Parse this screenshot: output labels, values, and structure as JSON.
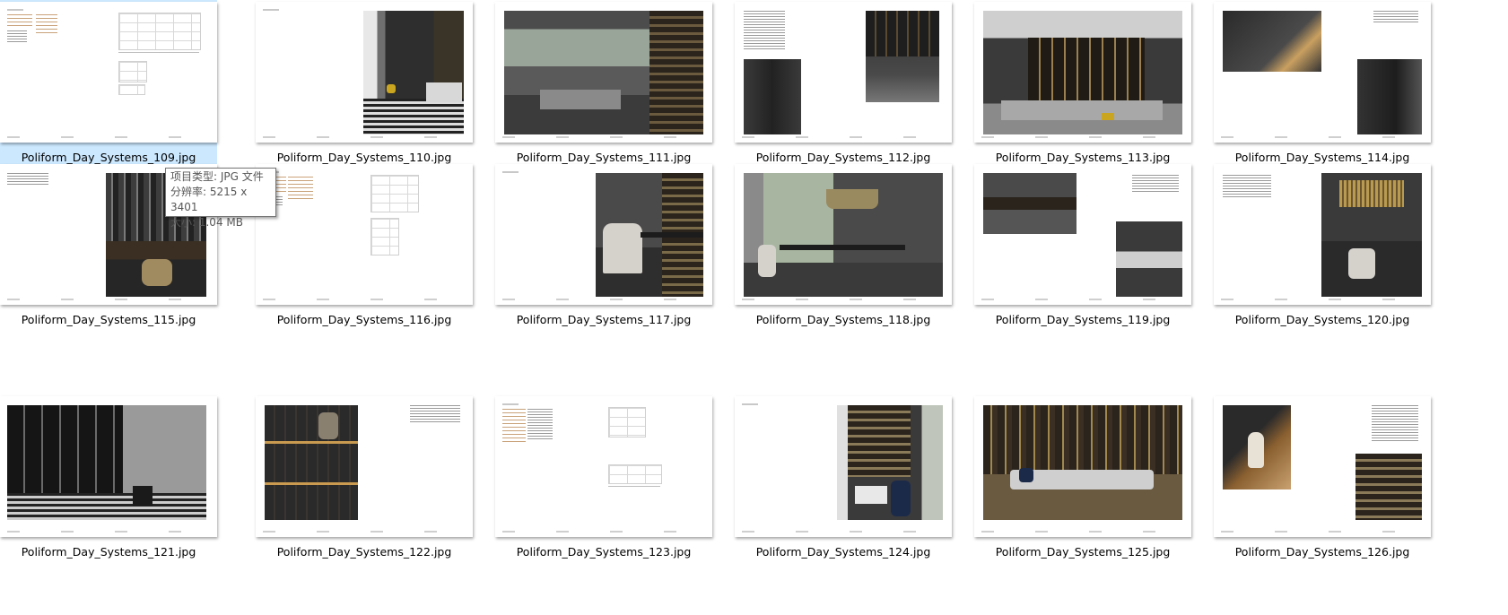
{
  "files": [
    {
      "name": "Poliform_Day_Systems_109.jpg",
      "selected": true
    },
    {
      "name": "Poliform_Day_Systems_110.jpg"
    },
    {
      "name": "Poliform_Day_Systems_111.jpg"
    },
    {
      "name": "Poliform_Day_Systems_112.jpg"
    },
    {
      "name": "Poliform_Day_Systems_113.jpg"
    },
    {
      "name": "Poliform_Day_Systems_114.jpg"
    },
    {
      "name": "Poliform_Day_Systems_115.jpg"
    },
    {
      "name": "Poliform_Day_Systems_116.jpg"
    },
    {
      "name": "Poliform_Day_Systems_117.jpg"
    },
    {
      "name": "Poliform_Day_Systems_118.jpg"
    },
    {
      "name": "Poliform_Day_Systems_119.jpg"
    },
    {
      "name": "Poliform_Day_Systems_120.jpg"
    },
    {
      "name": "Poliform_Day_Systems_121.jpg"
    },
    {
      "name": "Poliform_Day_Systems_122.jpg"
    },
    {
      "name": "Poliform_Day_Systems_123.jpg"
    },
    {
      "name": "Poliform_Day_Systems_124.jpg"
    },
    {
      "name": "Poliform_Day_Systems_125.jpg"
    },
    {
      "name": "Poliform_Day_Systems_126.jpg"
    }
  ],
  "tooltip": {
    "type": "项目类型: JPG 文件",
    "resolution": "分辨率: 5215 x 3401",
    "size": "大小: 1.04 MB"
  },
  "colors": {
    "selection": "#cce8ff",
    "caption": "#000000"
  }
}
